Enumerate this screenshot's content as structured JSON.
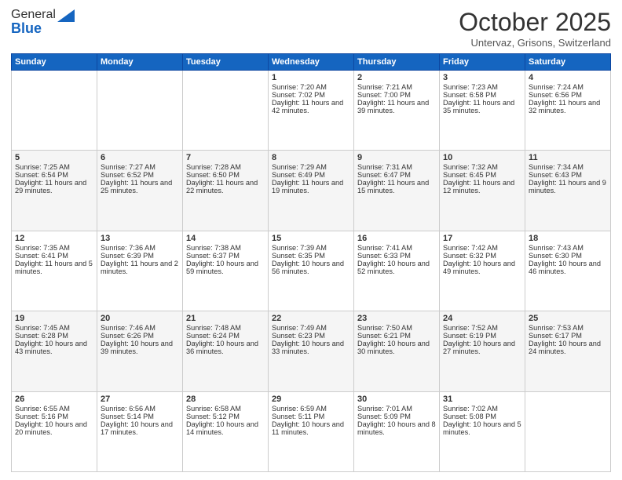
{
  "header": {
    "logo_general": "General",
    "logo_blue": "Blue",
    "month": "October 2025",
    "location": "Untervaz, Grisons, Switzerland"
  },
  "weekdays": [
    "Sunday",
    "Monday",
    "Tuesday",
    "Wednesday",
    "Thursday",
    "Friday",
    "Saturday"
  ],
  "weeks": [
    [
      {
        "day": "",
        "info": ""
      },
      {
        "day": "",
        "info": ""
      },
      {
        "day": "",
        "info": ""
      },
      {
        "day": "1",
        "info": "Sunrise: 7:20 AM\nSunset: 7:02 PM\nDaylight: 11 hours and 42 minutes."
      },
      {
        "day": "2",
        "info": "Sunrise: 7:21 AM\nSunset: 7:00 PM\nDaylight: 11 hours and 39 minutes."
      },
      {
        "day": "3",
        "info": "Sunrise: 7:23 AM\nSunset: 6:58 PM\nDaylight: 11 hours and 35 minutes."
      },
      {
        "day": "4",
        "info": "Sunrise: 7:24 AM\nSunset: 6:56 PM\nDaylight: 11 hours and 32 minutes."
      }
    ],
    [
      {
        "day": "5",
        "info": "Sunrise: 7:25 AM\nSunset: 6:54 PM\nDaylight: 11 hours and 29 minutes."
      },
      {
        "day": "6",
        "info": "Sunrise: 7:27 AM\nSunset: 6:52 PM\nDaylight: 11 hours and 25 minutes."
      },
      {
        "day": "7",
        "info": "Sunrise: 7:28 AM\nSunset: 6:50 PM\nDaylight: 11 hours and 22 minutes."
      },
      {
        "day": "8",
        "info": "Sunrise: 7:29 AM\nSunset: 6:49 PM\nDaylight: 11 hours and 19 minutes."
      },
      {
        "day": "9",
        "info": "Sunrise: 7:31 AM\nSunset: 6:47 PM\nDaylight: 11 hours and 15 minutes."
      },
      {
        "day": "10",
        "info": "Sunrise: 7:32 AM\nSunset: 6:45 PM\nDaylight: 11 hours and 12 minutes."
      },
      {
        "day": "11",
        "info": "Sunrise: 7:34 AM\nSunset: 6:43 PM\nDaylight: 11 hours and 9 minutes."
      }
    ],
    [
      {
        "day": "12",
        "info": "Sunrise: 7:35 AM\nSunset: 6:41 PM\nDaylight: 11 hours and 5 minutes."
      },
      {
        "day": "13",
        "info": "Sunrise: 7:36 AM\nSunset: 6:39 PM\nDaylight: 11 hours and 2 minutes."
      },
      {
        "day": "14",
        "info": "Sunrise: 7:38 AM\nSunset: 6:37 PM\nDaylight: 10 hours and 59 minutes."
      },
      {
        "day": "15",
        "info": "Sunrise: 7:39 AM\nSunset: 6:35 PM\nDaylight: 10 hours and 56 minutes."
      },
      {
        "day": "16",
        "info": "Sunrise: 7:41 AM\nSunset: 6:33 PM\nDaylight: 10 hours and 52 minutes."
      },
      {
        "day": "17",
        "info": "Sunrise: 7:42 AM\nSunset: 6:32 PM\nDaylight: 10 hours and 49 minutes."
      },
      {
        "day": "18",
        "info": "Sunrise: 7:43 AM\nSunset: 6:30 PM\nDaylight: 10 hours and 46 minutes."
      }
    ],
    [
      {
        "day": "19",
        "info": "Sunrise: 7:45 AM\nSunset: 6:28 PM\nDaylight: 10 hours and 43 minutes."
      },
      {
        "day": "20",
        "info": "Sunrise: 7:46 AM\nSunset: 6:26 PM\nDaylight: 10 hours and 39 minutes."
      },
      {
        "day": "21",
        "info": "Sunrise: 7:48 AM\nSunset: 6:24 PM\nDaylight: 10 hours and 36 minutes."
      },
      {
        "day": "22",
        "info": "Sunrise: 7:49 AM\nSunset: 6:23 PM\nDaylight: 10 hours and 33 minutes."
      },
      {
        "day": "23",
        "info": "Sunrise: 7:50 AM\nSunset: 6:21 PM\nDaylight: 10 hours and 30 minutes."
      },
      {
        "day": "24",
        "info": "Sunrise: 7:52 AM\nSunset: 6:19 PM\nDaylight: 10 hours and 27 minutes."
      },
      {
        "day": "25",
        "info": "Sunrise: 7:53 AM\nSunset: 6:17 PM\nDaylight: 10 hours and 24 minutes."
      }
    ],
    [
      {
        "day": "26",
        "info": "Sunrise: 6:55 AM\nSunset: 5:16 PM\nDaylight: 10 hours and 20 minutes."
      },
      {
        "day": "27",
        "info": "Sunrise: 6:56 AM\nSunset: 5:14 PM\nDaylight: 10 hours and 17 minutes."
      },
      {
        "day": "28",
        "info": "Sunrise: 6:58 AM\nSunset: 5:12 PM\nDaylight: 10 hours and 14 minutes."
      },
      {
        "day": "29",
        "info": "Sunrise: 6:59 AM\nSunset: 5:11 PM\nDaylight: 10 hours and 11 minutes."
      },
      {
        "day": "30",
        "info": "Sunrise: 7:01 AM\nSunset: 5:09 PM\nDaylight: 10 hours and 8 minutes."
      },
      {
        "day": "31",
        "info": "Sunrise: 7:02 AM\nSunset: 5:08 PM\nDaylight: 10 hours and 5 minutes."
      },
      {
        "day": "",
        "info": ""
      }
    ]
  ]
}
